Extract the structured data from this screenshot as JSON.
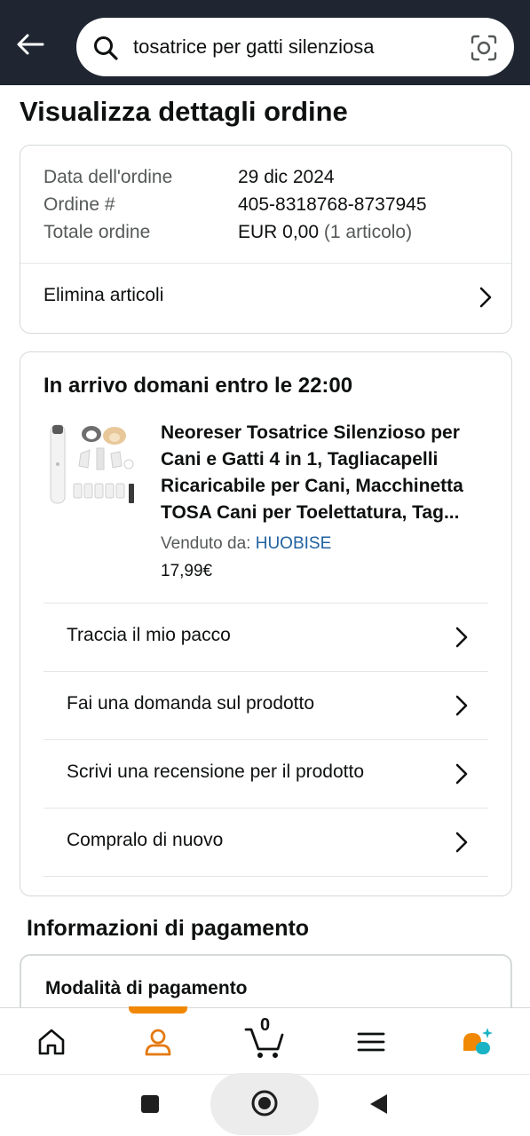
{
  "search": {
    "query": "tosatrice per gatti silenziosa"
  },
  "page": {
    "title": "Visualizza dettagli ordine"
  },
  "order_summary": {
    "date_label": "Data dell'ordine",
    "date_value": "29 dic 2024",
    "order_label": "Ordine #",
    "order_value": "405-8318768-8737945",
    "total_label": "Totale ordine",
    "total_value": "EUR 0,00",
    "total_count": "(1 articolo)",
    "remove_items": "Elimina articoli"
  },
  "delivery": {
    "title": "In arrivo domani entro le 22:00",
    "product_title": "Neoreser Tosatrice Silenzioso per Cani e Gatti 4 in 1, Tagliacapelli Ricaricabile per Cani, Macchinetta TOSA Cani per Toelettatura, Tag...",
    "seller_label": "Venduto da:",
    "seller_name": "HUOBISE",
    "price": "17,99€",
    "actions": [
      "Traccia il mio pacco",
      "Fai una domanda sul prodotto",
      "Scrivi una recensione per il prodotto",
      "Compralo di nuovo"
    ]
  },
  "payment": {
    "section_title": "Informazioni di pagamento",
    "method_label": "Modalità di pagamento"
  },
  "bottom_nav": {
    "cart_count": "0",
    "active": "account"
  },
  "colors": {
    "header_bg": "#1f2632",
    "accent_orange": "#f08804",
    "link_blue": "#2162a1",
    "ai_teal": "#1ab3c4"
  }
}
